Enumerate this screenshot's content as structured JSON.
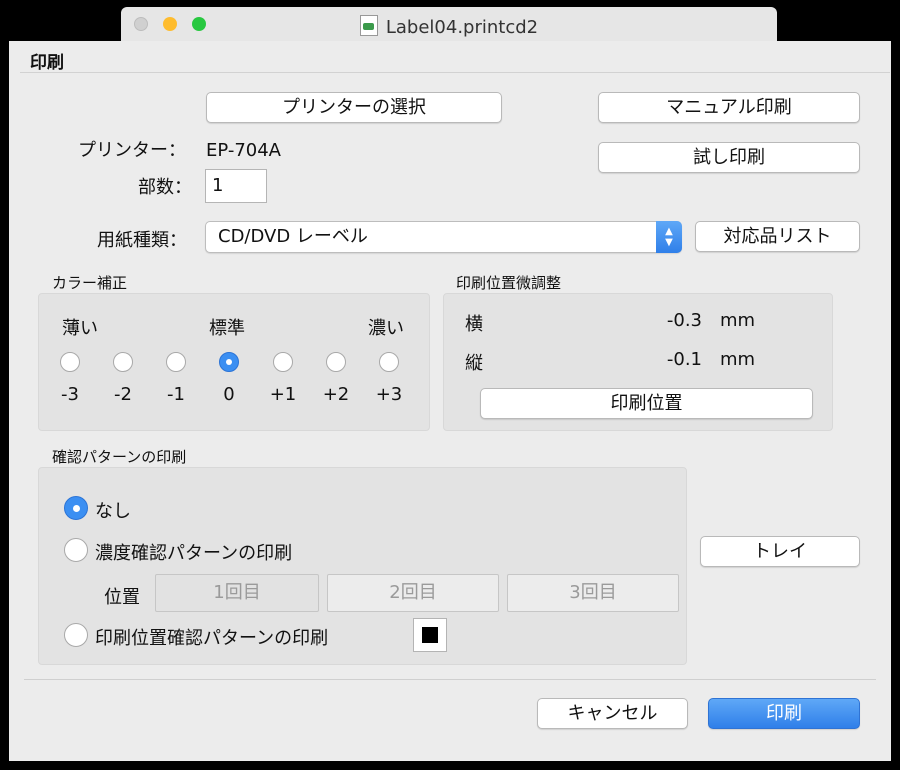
{
  "window": {
    "title": "Label04.printcd2"
  },
  "sheet": {
    "title": "印刷"
  },
  "printer": {
    "select_button": "プリンターの選択",
    "label": "プリンター：",
    "name": "EP-704A",
    "copies_label": "部数：",
    "copies_value": "1",
    "manual_print_button": "マニュアル印刷",
    "test_print_button": "試し印刷"
  },
  "paper": {
    "label": "用紙種類：",
    "selected": "CD/DVD レーベル",
    "compat_list_button": "対応品リスト"
  },
  "color_correction": {
    "title": "カラー補正",
    "light_label": "薄い",
    "standard_label": "標準",
    "dark_label": "濃い",
    "options": [
      "-3",
      "-2",
      "-1",
      "0",
      "+1",
      "+2",
      "+3"
    ],
    "selected": "0"
  },
  "position_adjust": {
    "title": "印刷位置微調整",
    "horizontal_label": "横",
    "horizontal_value": "-0.3",
    "vertical_label": "縦",
    "vertical_value": "-0.1",
    "unit": "mm",
    "button": "印刷位置"
  },
  "check_pattern": {
    "title": "確認パターンの印刷",
    "none_label": "なし",
    "density_label": "濃度確認パターンの印刷",
    "position_row_label": "位置",
    "round_buttons": [
      "1回目",
      "2回目",
      "3回目"
    ],
    "position_check_label": "印刷位置確認パターンの印刷",
    "selected": "なし"
  },
  "tray_button": "トレイ",
  "footer": {
    "cancel_button": "キャンセル",
    "print_button": "印刷"
  },
  "colors": {
    "accent": "#3b8ff2",
    "primary_button": "#2f7fe9",
    "traffic_red": "#ff5f57",
    "traffic_yellow": "#febc2e",
    "traffic_green": "#28c840"
  }
}
